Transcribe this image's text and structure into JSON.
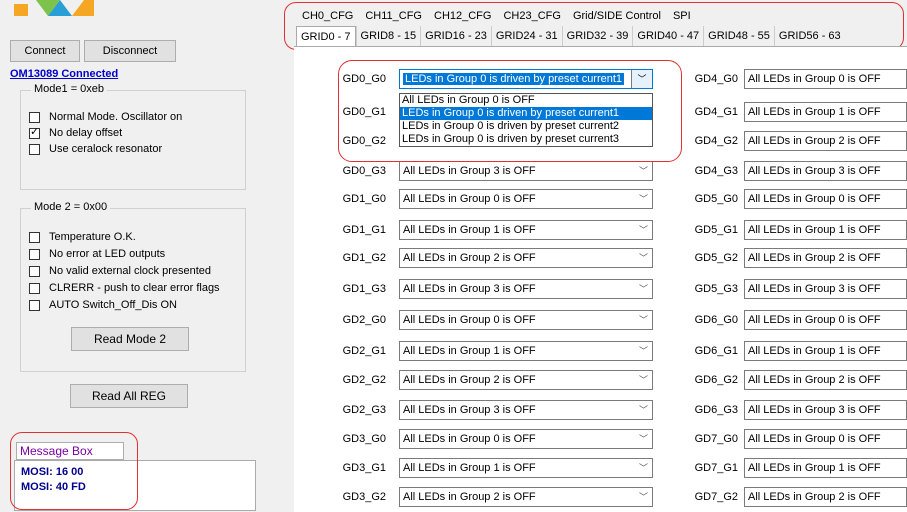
{
  "toolbar": {
    "connect_label": "Connect",
    "disconnect_label": "Disconnect"
  },
  "status": {
    "connection": "OM13089 Connected"
  },
  "mode1": {
    "title": "Mode1 = 0xeb",
    "options": [
      {
        "label": "Normal Mode. Oscillator on",
        "checked": false
      },
      {
        "label": "No delay offset",
        "checked": true
      },
      {
        "label": "Use ceralock resonator",
        "checked": false
      }
    ]
  },
  "mode2": {
    "title": "Mode 2 = 0x00",
    "options": [
      {
        "label": "Temperature O.K.",
        "checked": false
      },
      {
        "label": "No error at LED outputs",
        "checked": false
      },
      {
        "label": "No valid external clock presented",
        "checked": false
      },
      {
        "label": "CLRERR - push to clear error flags",
        "checked": false
      },
      {
        "label": "AUTO Switch_Off_Dis ON",
        "checked": false
      }
    ],
    "read_label": "Read Mode 2"
  },
  "read_all_label": "Read All REG",
  "message_box": {
    "label": "Message Box",
    "lines": [
      "MOSI: 16 00",
      "MOSI: 40 FD"
    ]
  },
  "tabs_top": [
    "CH0_CFG",
    "CH11_CFG",
    "CH12_CFG",
    "CH23_CFG",
    "Grid/SIDE Control",
    "SPI"
  ],
  "tabs_bottom": [
    "GRID0 - 7",
    "GRID8 - 15",
    "GRID16 - 23",
    "GRID24 - 31",
    "GRID32 - 39",
    "GRID40 - 47",
    "GRID48 - 55",
    "GRID56 - 63"
  ],
  "active_tab": "GRID0 - 7",
  "left_column": [
    {
      "label": "GD0_G0",
      "value": "LEDs in Group 0 is driven by preset current1"
    },
    {
      "label": "GD0_G1",
      "value": ""
    },
    {
      "label": "GD0_G2",
      "value": ""
    },
    {
      "label": "GD0_G3",
      "value": "All LEDs in Group 3 is OFF"
    },
    {
      "label": "GD1_G0",
      "value": "All LEDs in Group 0 is OFF"
    },
    {
      "label": "GD1_G1",
      "value": "All LEDs in Group 1 is OFF"
    },
    {
      "label": "GD1_G2",
      "value": "All LEDs in Group 2 is OFF"
    },
    {
      "label": "GD1_G3",
      "value": "All LEDs in Group 3 is OFF"
    },
    {
      "label": "GD2_G0",
      "value": "All LEDs in Group 0 is OFF"
    },
    {
      "label": "GD2_G1",
      "value": "All LEDs in Group 1 is OFF"
    },
    {
      "label": "GD2_G2",
      "value": "All LEDs in Group 2 is OFF"
    },
    {
      "label": "GD2_G3",
      "value": "All LEDs in Group 3 is OFF"
    },
    {
      "label": "GD3_G0",
      "value": "All LEDs in Group 0 is OFF"
    },
    {
      "label": "GD3_G1",
      "value": "All LEDs in Group 1 is OFF"
    },
    {
      "label": "GD3_G2",
      "value": "All LEDs in Group 2 is OFF"
    }
  ],
  "right_column": [
    {
      "label": "GD4_G0",
      "value": "All LEDs in Group 0 is OFF"
    },
    {
      "label": "GD4_G1",
      "value": "All LEDs in Group 1 is OFF"
    },
    {
      "label": "GD4_G2",
      "value": "All LEDs in Group 2 is OFF"
    },
    {
      "label": "GD4_G3",
      "value": "All LEDs in Group 3 is OFF"
    },
    {
      "label": "GD5_G0",
      "value": "All LEDs in Group 0 is OFF"
    },
    {
      "label": "GD5_G1",
      "value": "All LEDs in Group 1 is OFF"
    },
    {
      "label": "GD5_G2",
      "value": "All LEDs in Group 2 is OFF"
    },
    {
      "label": "GD5_G3",
      "value": "All LEDs in Group 3 is OFF"
    },
    {
      "label": "GD6_G0",
      "value": "All LEDs in Group 0 is OFF"
    },
    {
      "label": "GD6_G1",
      "value": "All LEDs in Group 1 is OFF"
    },
    {
      "label": "GD6_G2",
      "value": "All LEDs in Group 2 is OFF"
    },
    {
      "label": "GD6_G3",
      "value": "All LEDs in Group 3 is OFF"
    },
    {
      "label": "GD7_G0",
      "value": "All LEDs in Group 0 is OFF"
    },
    {
      "label": "GD7_G1",
      "value": "All LEDs in Group 1 is OFF"
    },
    {
      "label": "GD7_G2",
      "value": "All LEDs in Group 2 is OFF"
    }
  ],
  "dropdown": {
    "options": [
      "All LEDs in Group 0 is OFF",
      "LEDs in Group 0 is driven by preset current1",
      "LEDs in Group 0 is driven by preset current2",
      "LEDs in Group 0 is driven by preset current3"
    ],
    "selected_index": 1
  },
  "colors": {
    "highlight": "#0078d7",
    "annotation": "#e03030",
    "status_link": "#0000cc"
  }
}
